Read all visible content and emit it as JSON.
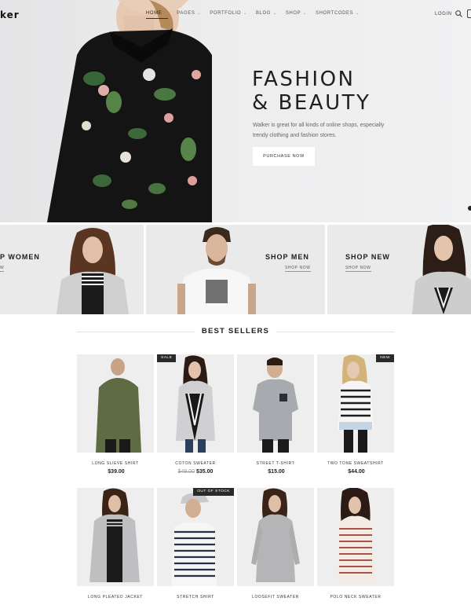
{
  "header": {
    "logo": "ker",
    "nav": [
      {
        "label": "HOME",
        "active": true
      },
      {
        "label": "PAGES",
        "active": false
      },
      {
        "label": "PORTFOLIO",
        "active": false
      },
      {
        "label": "BLOG",
        "active": false
      },
      {
        "label": "SHOP",
        "active": false
      },
      {
        "label": "SHORTCODES",
        "active": false
      }
    ],
    "login": "LOGIN",
    "icons": [
      "search-icon",
      "cart-icon"
    ]
  },
  "hero": {
    "title_line1": "FASHION",
    "title_line2": "& BEAUTY",
    "description": "Walker is great for all kinds of online shops, especially trendy clothing and fashion stores.",
    "button": "PURCHASE NOW"
  },
  "categories": [
    {
      "title": "P WOMEN",
      "link": "W"
    },
    {
      "title": "SHOP MEN",
      "link": "SHOP NOW"
    },
    {
      "title": "SHOP NEW",
      "link": "SHOP NOW"
    }
  ],
  "best_sellers": {
    "title": "BEST SELLERS",
    "products": [
      {
        "name": "LONG SLIEVE SHIRT",
        "price": "$39.00",
        "old_price": "",
        "badge": ""
      },
      {
        "name": "COTON SWEATER",
        "price": "$35.00",
        "old_price": "$49.00",
        "badge": "SALE"
      },
      {
        "name": "STREET T-SHIRT",
        "price": "$15.00",
        "old_price": "",
        "badge": ""
      },
      {
        "name": "TWO TONE SWEATSHIRT",
        "price": "$44.00",
        "old_price": "",
        "badge": "NEW"
      },
      {
        "name": "LONG PLEATED JACKET",
        "price": "",
        "old_price": "",
        "badge": ""
      },
      {
        "name": "STRETCH SHIRT",
        "price": "",
        "old_price": "",
        "badge": "OUT OF STOCK"
      },
      {
        "name": "LOOSEFIT SWEATER",
        "price": "",
        "old_price": "",
        "badge": ""
      },
      {
        "name": "POLO NECK SWEATER",
        "price": "",
        "old_price": "",
        "badge": ""
      }
    ]
  },
  "colors": {
    "accent": "#1f1f1f",
    "badge_bg": "#2a2a2a",
    "panel_bg": "#eaeaeb"
  }
}
